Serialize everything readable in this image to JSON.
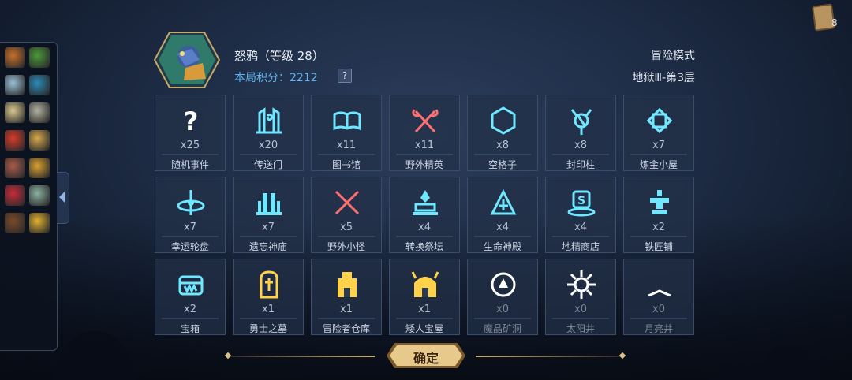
{
  "hero": {
    "name": "怒鸦（等级 28）",
    "score": "本局积分：2212",
    "help": "?"
  },
  "mode": {
    "title": "冒险模式",
    "level": "地狱Ⅲ-第3层"
  },
  "cards": {
    "count": "8"
  },
  "confirm": "确定",
  "colors": {
    "accent_blue": "#5fb4f0",
    "icon_cyan": "#6fe8ff",
    "icon_gold": "#ffd24a",
    "icon_white": "#ffffff",
    "icon_red": "#ff6f6f"
  },
  "inventory": [
    "torch",
    "green-pack",
    "map",
    "blue-shell",
    "scroll",
    "scroll-stone",
    "chili",
    "alchemy-palette",
    "meat",
    "gold-glove",
    "red-orb",
    "potion",
    "tome",
    "gold-bars"
  ],
  "events": [
    {
      "name": "随机事件",
      "count": "x25",
      "icon": "question-icon",
      "color": "#ffffff"
    },
    {
      "name": "传送门",
      "count": "x20",
      "icon": "portal-icon",
      "color": "#6fe8ff"
    },
    {
      "name": "图书馆",
      "count": "x11",
      "icon": "library-icon",
      "color": "#6fe8ff"
    },
    {
      "name": "野外精英",
      "count": "x11",
      "icon": "crossed-axes-icon",
      "color": "#ff6f6f"
    },
    {
      "name": "空格子",
      "count": "x8",
      "icon": "hexagon-icon",
      "color": "#6fe8ff"
    },
    {
      "name": "封印柱",
      "count": "x8",
      "icon": "seal-pillar-icon",
      "color": "#6fe8ff"
    },
    {
      "name": "炼金小屋",
      "count": "x7",
      "icon": "alchemy-icon",
      "color": "#6fe8ff"
    },
    {
      "name": "幸运轮盘",
      "count": "x7",
      "icon": "roulette-icon",
      "color": "#6fe8ff"
    },
    {
      "name": "遗忘神庙",
      "count": "x7",
      "icon": "temple-icon",
      "color": "#6fe8ff"
    },
    {
      "name": "野外小怪",
      "count": "x5",
      "icon": "crossed-swords-icon",
      "color": "#ff6f6f"
    },
    {
      "name": "转换祭坛",
      "count": "x4",
      "icon": "altar-icon",
      "color": "#6fe8ff"
    },
    {
      "name": "生命神殿",
      "count": "x4",
      "icon": "life-shrine-icon",
      "color": "#6fe8ff"
    },
    {
      "name": "地精商店",
      "count": "x4",
      "icon": "goblin-shop-icon",
      "color": "#6fe8ff"
    },
    {
      "name": "铁匠铺",
      "count": "x2",
      "icon": "anvil-icon",
      "color": "#6fe8ff"
    },
    {
      "name": "宝箱",
      "count": "x2",
      "icon": "chest-icon",
      "color": "#6fe8ff"
    },
    {
      "name": "勇士之墓",
      "count": "x1",
      "icon": "tomb-icon",
      "color": "#ffd24a"
    },
    {
      "name": "冒险者仓库",
      "count": "x1",
      "icon": "warehouse-icon",
      "color": "#ffd24a"
    },
    {
      "name": "矮人宝屋",
      "count": "x1",
      "icon": "dwarf-house-icon",
      "color": "#ffd24a"
    },
    {
      "name": "魔晶矿洞",
      "count": "x0",
      "icon": "crystal-mine-icon",
      "color": "#ffffff"
    },
    {
      "name": "太阳井",
      "count": "x0",
      "icon": "sun-well-icon",
      "color": "#ffffff"
    },
    {
      "name": "月亮井",
      "count": "x0",
      "icon": "moon-well-icon",
      "color": "#ffffff"
    }
  ]
}
